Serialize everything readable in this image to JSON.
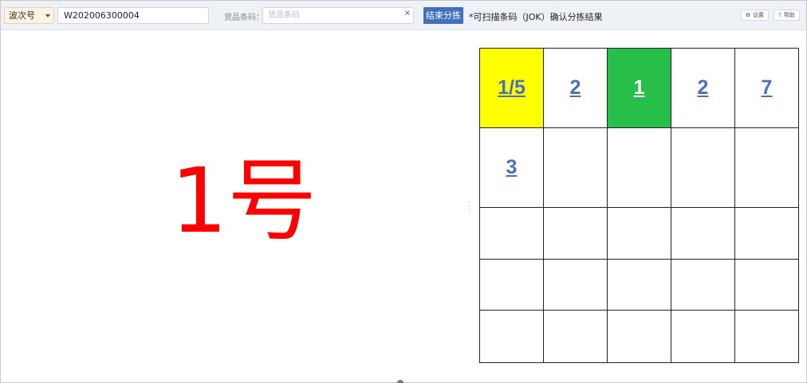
{
  "toolbar": {
    "wave_select_label": "波次号",
    "wave_number": "W202006300004",
    "barcode_label": "货品条码：",
    "barcode_placeholder": "货品条码",
    "clear_symbol": "×",
    "end_sorting_label": "结束分拣",
    "hint": "*可扫描条码（JOK）确认分拣结果",
    "settings_label": "设置",
    "help_label": "帮助",
    "settings_icon": "gear-icon",
    "help_icon": "question-icon"
  },
  "main": {
    "current_slot": "1号"
  },
  "grid": {
    "rows": [
      [
        {
          "text": "1/5",
          "color": "#ffff00"
        },
        {
          "text": "2"
        },
        {
          "text": "1",
          "color": "#27be4a"
        },
        {
          "text": "2"
        },
        {
          "text": "7"
        }
      ],
      [
        {
          "text": "3"
        },
        {
          "text": ""
        },
        {
          "text": ""
        },
        {
          "text": ""
        },
        {
          "text": ""
        }
      ],
      [
        {
          "text": ""
        },
        {
          "text": ""
        },
        {
          "text": ""
        },
        {
          "text": ""
        },
        {
          "text": ""
        }
      ],
      [
        {
          "text": ""
        },
        {
          "text": ""
        },
        {
          "text": ""
        },
        {
          "text": ""
        },
        {
          "text": ""
        }
      ],
      [
        {
          "text": ""
        },
        {
          "text": ""
        },
        {
          "text": ""
        },
        {
          "text": ""
        },
        {
          "text": ""
        }
      ]
    ]
  }
}
